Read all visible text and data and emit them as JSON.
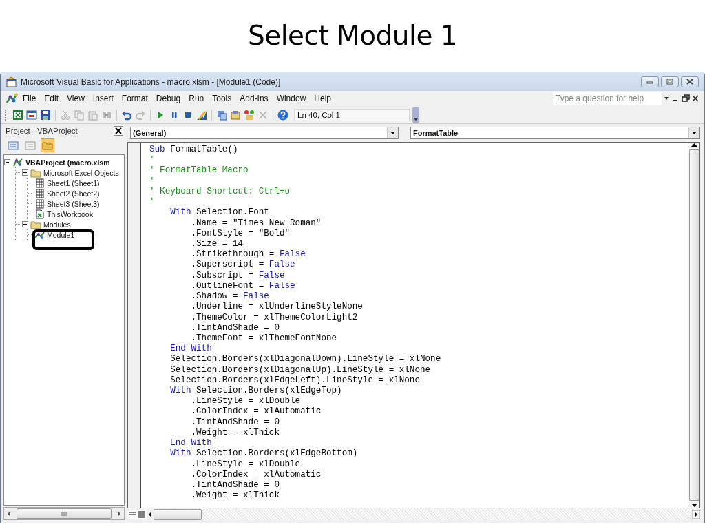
{
  "slide": {
    "title": "Select Module 1"
  },
  "window": {
    "title": "Microsoft Visual Basic for Applications - macro.xlsm - [Module1 (Code)]"
  },
  "menu": [
    "File",
    "Edit",
    "View",
    "Insert",
    "Format",
    "Debug",
    "Run",
    "Tools",
    "Add-Ins",
    "Window",
    "Help"
  ],
  "help_search": {
    "placeholder": "Type a question for help"
  },
  "toolbar": {
    "position": "Ln 40, Col 1"
  },
  "project_panel": {
    "title": "Project - VBAProject",
    "tree": [
      {
        "label": "VBAProject (macro.xlsm",
        "kind": "project",
        "expanded": true,
        "children": [
          {
            "label": "Microsoft Excel Objects",
            "kind": "folder",
            "expanded": true,
            "children": [
              {
                "label": "Sheet1 (Sheet1)",
                "kind": "sheet"
              },
              {
                "label": "Sheet2 (Sheet2)",
                "kind": "sheet"
              },
              {
                "label": "Sheet3 (Sheet3)",
                "kind": "sheet"
              },
              {
                "label": "ThisWorkbook",
                "kind": "workbook"
              }
            ]
          },
          {
            "label": "Modules",
            "kind": "folder",
            "expanded": true,
            "children": [
              {
                "label": "Module1",
                "kind": "module",
                "highlighted": true
              }
            ]
          }
        ]
      }
    ]
  },
  "code_pane": {
    "object": "(General)",
    "procedure": "FormatTable",
    "lines": [
      [
        {
          "kind": "keyword",
          "text": "Sub"
        },
        {
          "kind": "plain",
          "text": " FormatTable()"
        }
      ],
      [
        {
          "kind": "comment",
          "text": "'"
        }
      ],
      [
        {
          "kind": "comment",
          "text": "' FormatTable Macro"
        }
      ],
      [
        {
          "kind": "comment",
          "text": "'"
        }
      ],
      [
        {
          "kind": "comment",
          "text": "' Keyboard Shortcut: Ctrl+o"
        }
      ],
      [
        {
          "kind": "comment",
          "text": "'"
        }
      ],
      [
        {
          "kind": "keyword",
          "text": "    With"
        },
        {
          "kind": "plain",
          "text": " Selection.Font"
        }
      ],
      [
        {
          "kind": "plain",
          "text": "        .Name = \"Times New Roman\""
        }
      ],
      [
        {
          "kind": "plain",
          "text": "        .FontStyle = \"Bold\""
        }
      ],
      [
        {
          "kind": "plain",
          "text": "        .Size = 14"
        }
      ],
      [
        {
          "kind": "plain",
          "text": "        .Strikethrough = "
        },
        {
          "kind": "keyword",
          "text": "False"
        }
      ],
      [
        {
          "kind": "plain",
          "text": "        .Superscript = "
        },
        {
          "kind": "keyword",
          "text": "False"
        }
      ],
      [
        {
          "kind": "plain",
          "text": "        .Subscript = "
        },
        {
          "kind": "keyword",
          "text": "False"
        }
      ],
      [
        {
          "kind": "plain",
          "text": "        .OutlineFont = "
        },
        {
          "kind": "keyword",
          "text": "False"
        }
      ],
      [
        {
          "kind": "plain",
          "text": "        .Shadow = "
        },
        {
          "kind": "keyword",
          "text": "False"
        }
      ],
      [
        {
          "kind": "plain",
          "text": "        .Underline = xlUnderlineStyleNone"
        }
      ],
      [
        {
          "kind": "plain",
          "text": "        .ThemeColor = xlThemeColorLight2"
        }
      ],
      [
        {
          "kind": "plain",
          "text": "        .TintAndShade = 0"
        }
      ],
      [
        {
          "kind": "plain",
          "text": "        .ThemeFont = xlThemeFontNone"
        }
      ],
      [
        {
          "kind": "keyword",
          "text": "    End With"
        }
      ],
      [
        {
          "kind": "plain",
          "text": "    Selection.Borders(xlDiagonalDown).LineStyle = xlNone"
        }
      ],
      [
        {
          "kind": "plain",
          "text": "    Selection.Borders(xlDiagonalUp).LineStyle = xlNone"
        }
      ],
      [
        {
          "kind": "plain",
          "text": "    Selection.Borders(xlEdgeLeft).LineStyle = xlNone"
        }
      ],
      [
        {
          "kind": "keyword",
          "text": "    With"
        },
        {
          "kind": "plain",
          "text": " Selection.Borders(xlEdgeTop)"
        }
      ],
      [
        {
          "kind": "plain",
          "text": "        .LineStyle = xlDouble"
        }
      ],
      [
        {
          "kind": "plain",
          "text": "        .ColorIndex = xlAutomatic"
        }
      ],
      [
        {
          "kind": "plain",
          "text": "        .TintAndShade = 0"
        }
      ],
      [
        {
          "kind": "plain",
          "text": "        .Weight = xlThick"
        }
      ],
      [
        {
          "kind": "keyword",
          "text": "    End With"
        }
      ],
      [
        {
          "kind": "keyword",
          "text": "    With"
        },
        {
          "kind": "plain",
          "text": " Selection.Borders(xlEdgeBottom)"
        }
      ],
      [
        {
          "kind": "plain",
          "text": "        .LineStyle = xlDouble"
        }
      ],
      [
        {
          "kind": "plain",
          "text": "        .ColorIndex = xlAutomatic"
        }
      ],
      [
        {
          "kind": "plain",
          "text": "        .TintAndShade = 0"
        }
      ],
      [
        {
          "kind": "plain",
          "text": "        .Weight = xlThick"
        }
      ]
    ]
  }
}
